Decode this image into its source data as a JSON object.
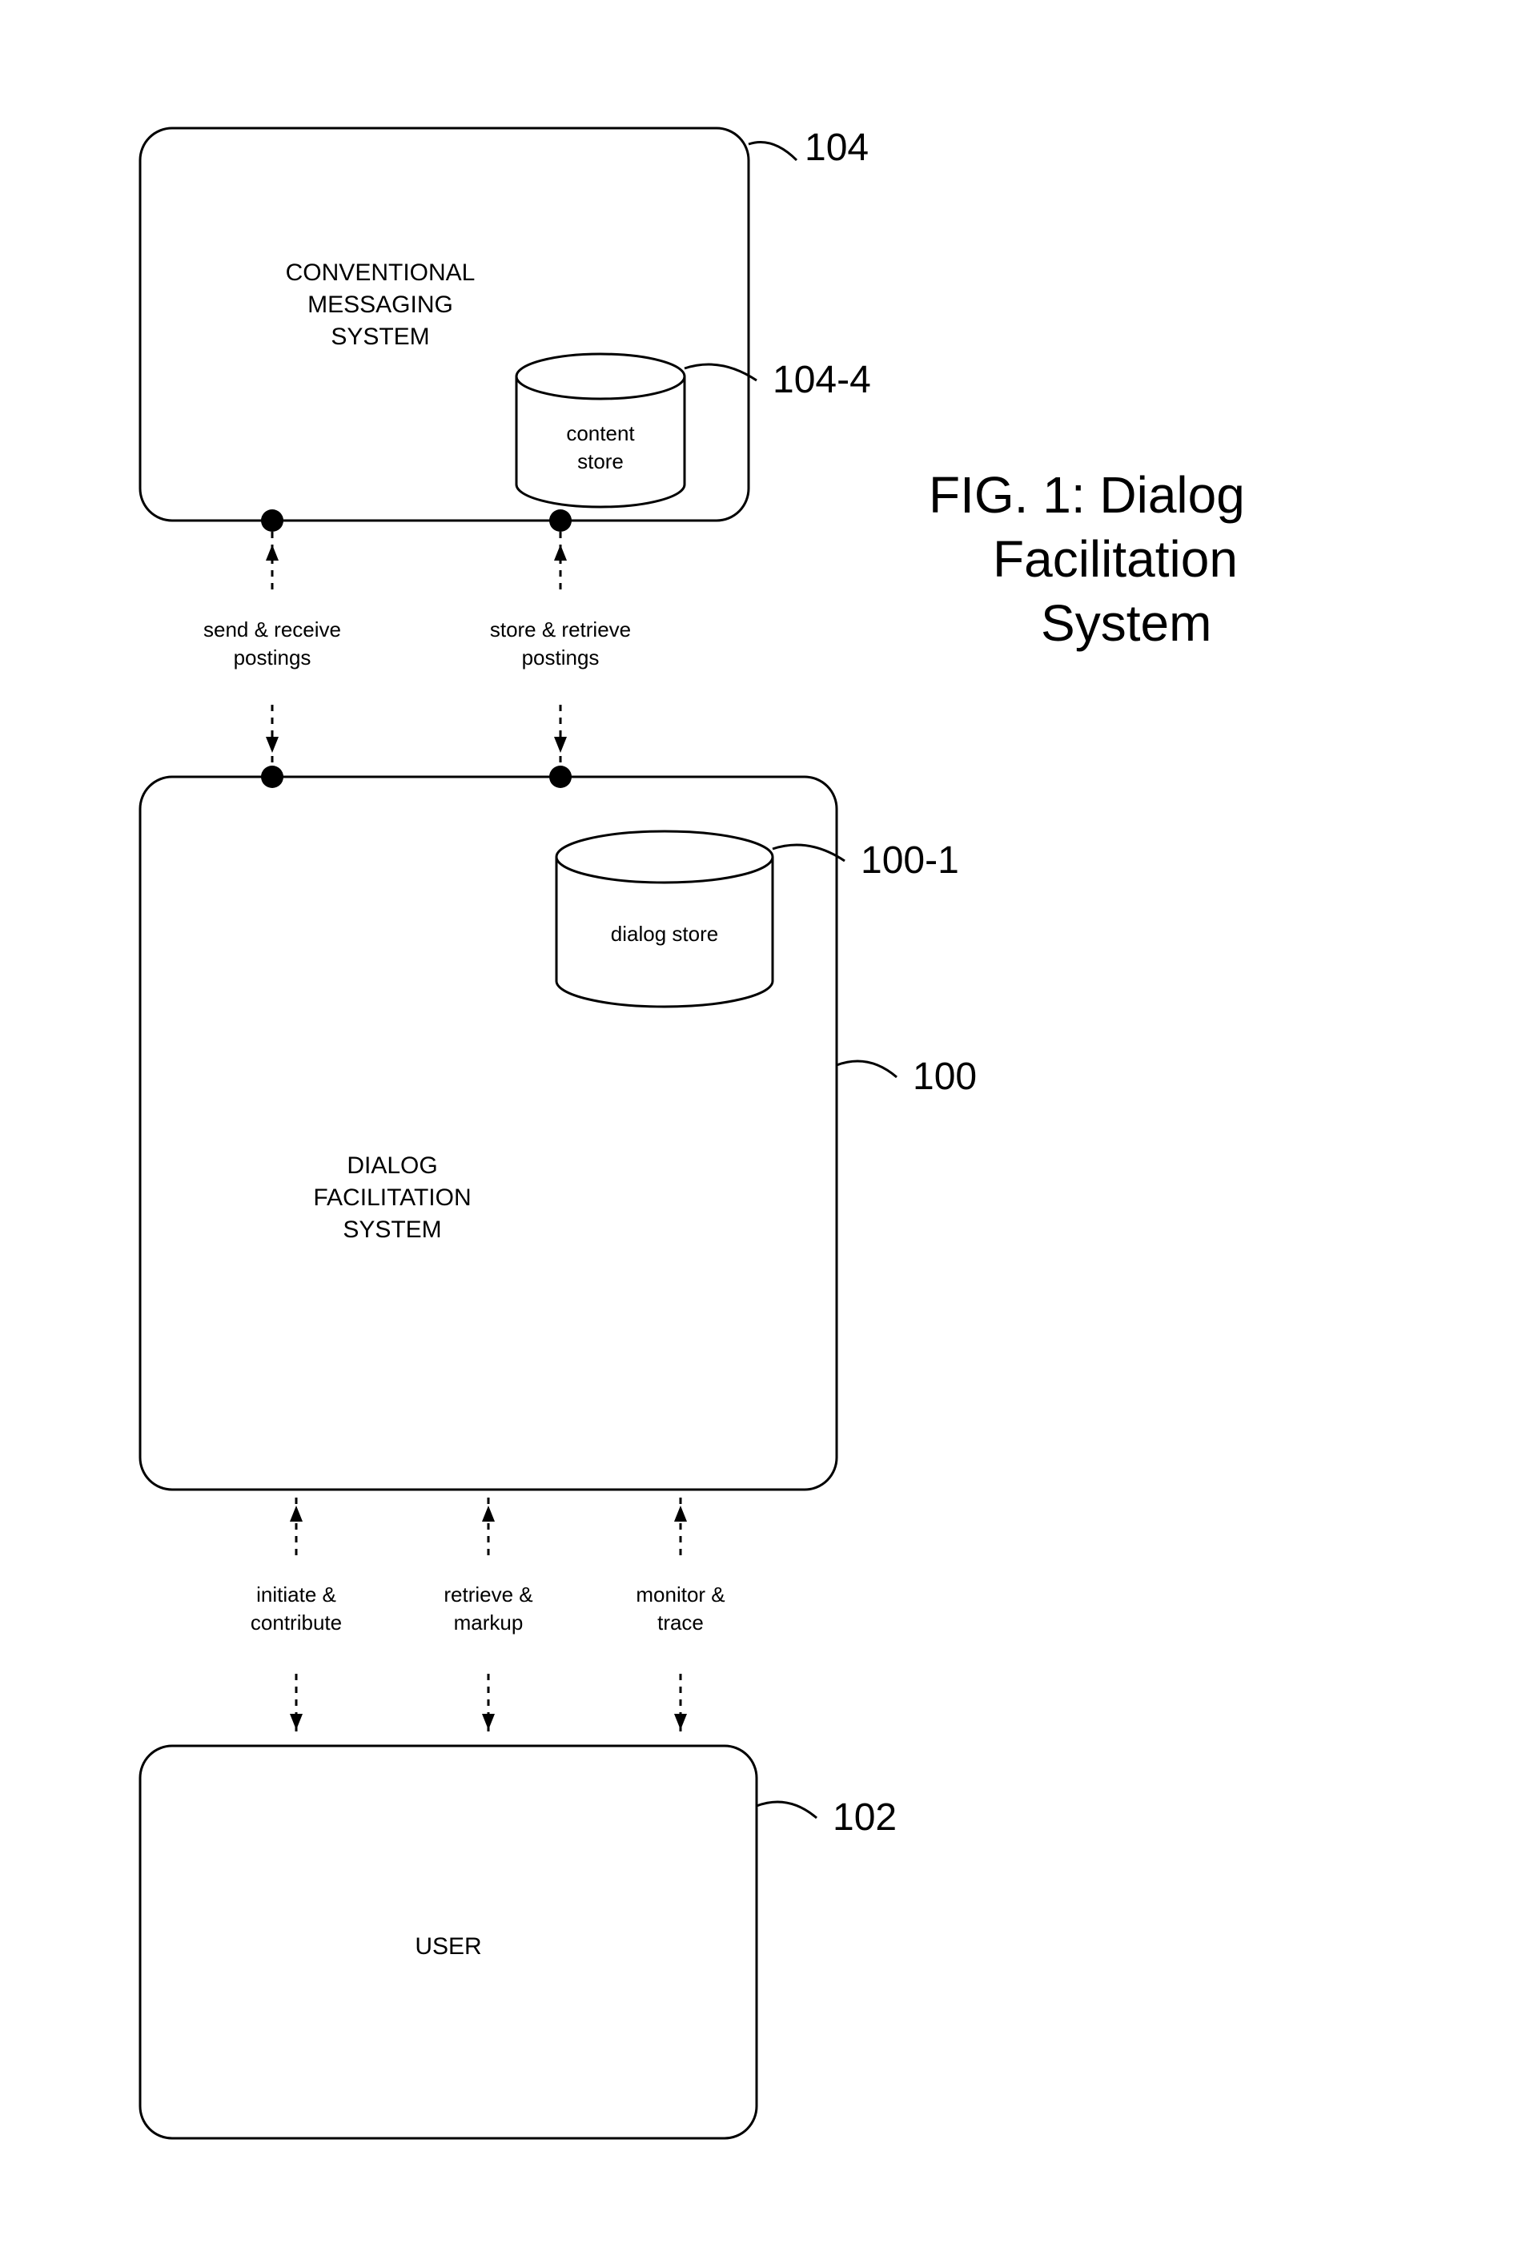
{
  "title": {
    "line1": "FIG. 1: Dialog",
    "line2": "Facilitation",
    "line3": "System"
  },
  "boxes": {
    "top": {
      "label_line1": "CONVENTIONAL",
      "label_line2": "MESSAGING",
      "label_line3": "SYSTEM",
      "ref": "104"
    },
    "mid": {
      "label_line1": "DIALOG",
      "label_line2": "FACILITATION",
      "label_line3": "SYSTEM",
      "ref": "100"
    },
    "bot": {
      "label_line1": "USER",
      "ref": "102"
    }
  },
  "cyls": {
    "content_store": {
      "line1": "content",
      "line2": "store",
      "ref": "104-4"
    },
    "dialog_store": {
      "line1": "dialog store",
      "ref": "100-1"
    }
  },
  "edges": {
    "tm_left": {
      "line1": "send & receive",
      "line2": "postings"
    },
    "tm_right": {
      "line1": "store & retrieve",
      "line2": "postings"
    },
    "mb_left": {
      "line1": "initiate &",
      "line2": "contribute"
    },
    "mb_mid": {
      "line1": "retrieve &",
      "line2": "markup"
    },
    "mb_right": {
      "line1": "monitor &",
      "line2": "trace"
    }
  }
}
